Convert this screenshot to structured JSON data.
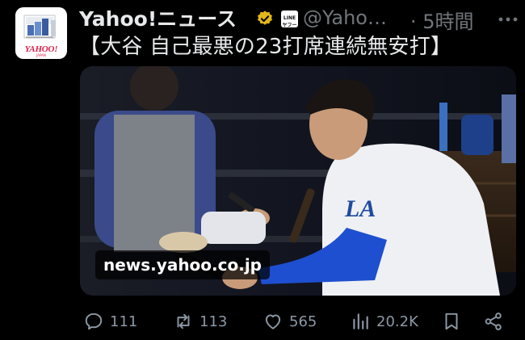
{
  "account": {
    "display_name": "Yahoo!ニュース",
    "handle": "@Yaho…",
    "time": "· 5時間",
    "avatar_logo_text": "YAHOO!",
    "avatar_logo_sub": "JAPAN",
    "affiliate_badge_text": "LINEヤフー",
    "verified_color": "#e2b719"
  },
  "tweet": {
    "text": "【大谷 自己最悪の23打席連続無安打】"
  },
  "media": {
    "domain": "news.yahoo.co.jp",
    "image_icon": "photo-dugout-player"
  },
  "actions": {
    "reply_count": "111",
    "retweet_count": "113",
    "like_count": "565",
    "view_count": "20.2K"
  },
  "colors": {
    "background": "#000000",
    "text": "#e7e9ea",
    "muted": "#71767b",
    "action_icon": "#8b98a5"
  }
}
